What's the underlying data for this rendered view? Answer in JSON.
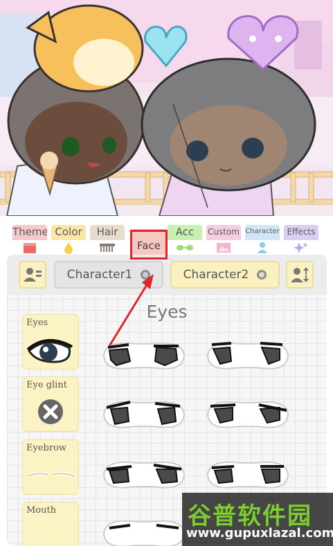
{
  "tabs": [
    {
      "label": "Theme",
      "color": "#f7c9cf",
      "icon": "clapperboard-icon"
    },
    {
      "label": "Color",
      "color": "#fbe6a8",
      "icon": "droplet-icon"
    },
    {
      "label": "Hair",
      "color": "#e8dccf",
      "icon": "comb-icon"
    },
    {
      "label": "Face",
      "color": "#f7c7c1",
      "icon": "face-icon"
    },
    {
      "label": "Acc",
      "color": "#c9f0b3",
      "icon": "glasses-icon"
    },
    {
      "label": "Custom",
      "color": "#f4cde3",
      "icon": "image-icon"
    },
    {
      "label": "Character",
      "color": "#cfe7f4",
      "icon": "person-icon"
    },
    {
      "label": "Effects",
      "color": "#d9cef4",
      "icon": "sparkle-icon"
    }
  ],
  "active_tab": "Face",
  "panel": {
    "character1": "Character1",
    "character2": "Character2",
    "title": "Eyes"
  },
  "features": [
    {
      "label": "Eyes"
    },
    {
      "label": "Eye glint"
    },
    {
      "label": "Eyebrow"
    },
    {
      "label": "Mouth"
    }
  ],
  "watermark": {
    "name": "谷普软件园",
    "url": "www.gupuxlazal.com"
  },
  "colors": {
    "highlight": "#e0262a",
    "panel_button": "#fbf0c0",
    "watermark_green": "#7ccd2f"
  }
}
